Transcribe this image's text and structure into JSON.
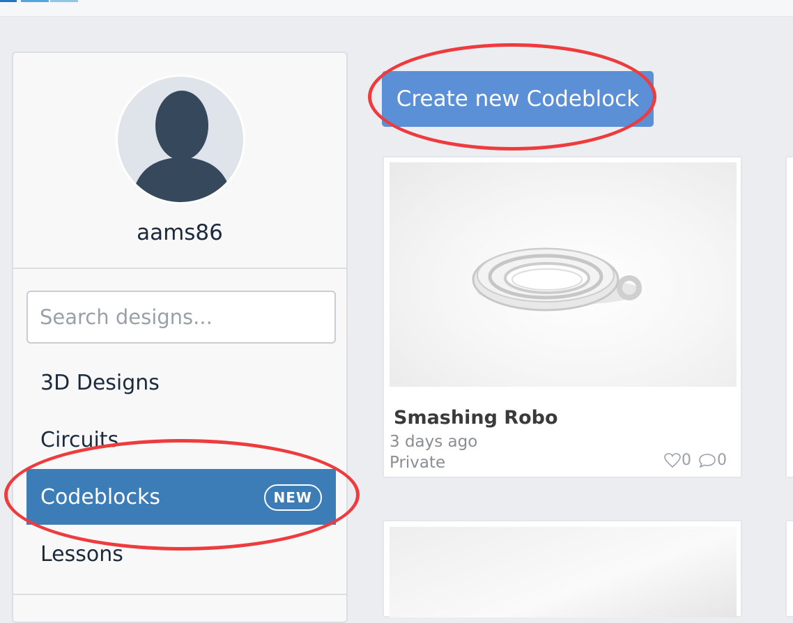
{
  "profile": {
    "username": "aams86"
  },
  "search": {
    "placeholder": "Search designs..."
  },
  "nav": {
    "items": [
      {
        "label": "3D Designs"
      },
      {
        "label": "Circuits"
      },
      {
        "label": "Codeblocks",
        "badge": "NEW",
        "active": true
      },
      {
        "label": "Lessons"
      }
    ]
  },
  "main": {
    "create_button_label": "Create new Codeblock"
  },
  "designs": [
    {
      "title": "Smashing Robo",
      "date": "3 days ago",
      "privacy": "Private",
      "likes": "0",
      "comments": "0"
    }
  ],
  "icons": {
    "avatar": "user-silhouette-icon",
    "likes": "heart-icon",
    "comments": "comment-icon"
  },
  "colors": {
    "accent": "#5b8fd6",
    "active_nav": "#3d7db7",
    "annotation": "#ee3b3d",
    "page_background": "#ecedf0"
  }
}
